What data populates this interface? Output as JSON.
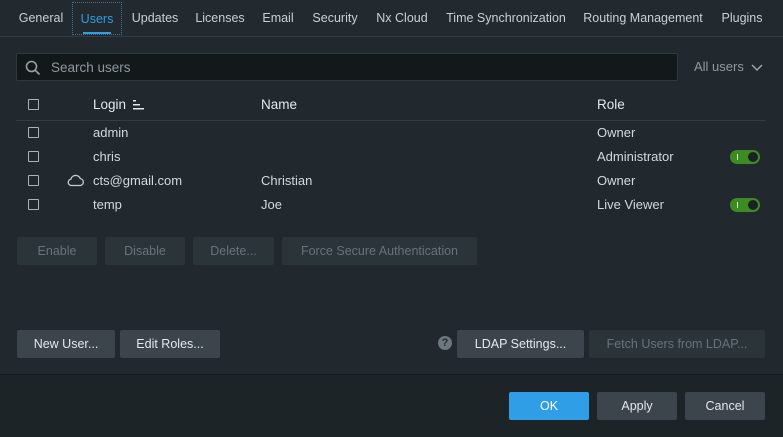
{
  "tabs": [
    {
      "label": "General"
    },
    {
      "label": "Users"
    },
    {
      "label": "Updates"
    },
    {
      "label": "Licenses"
    },
    {
      "label": "Email"
    },
    {
      "label": "Security"
    },
    {
      "label": "Nx Cloud"
    },
    {
      "label": "Time Synchronization"
    },
    {
      "label": "Routing Management"
    },
    {
      "label": "Plugins"
    }
  ],
  "active_tab": "Users",
  "search": {
    "placeholder": "Search users",
    "value": ""
  },
  "filter": {
    "label": "All users"
  },
  "table": {
    "headers": {
      "login": "Login",
      "name": "Name",
      "role": "Role"
    },
    "sort_column": "Login",
    "rows": [
      {
        "login": "admin",
        "name": "",
        "role": "Owner",
        "cloud": false,
        "enabled_toggle": false
      },
      {
        "login": "chris",
        "name": "",
        "role": "Administrator",
        "cloud": false,
        "enabled_toggle": true
      },
      {
        "login": "cts@gmail.com",
        "name": "Christian",
        "role": "Owner",
        "cloud": true,
        "enabled_toggle": false
      },
      {
        "login": "temp",
        "name": "Joe",
        "role": "Live Viewer",
        "cloud": false,
        "enabled_toggle": true
      }
    ]
  },
  "actions": {
    "enable": "Enable",
    "disable": "Disable",
    "delete": "Delete...",
    "force_secure_auth": "Force Secure Authentication"
  },
  "bottom": {
    "new_user": "New User...",
    "edit_roles": "Edit Roles...",
    "help": "?",
    "ldap_settings": "LDAP Settings...",
    "fetch_ldap": "Fetch Users from LDAP..."
  },
  "footer": {
    "ok": "OK",
    "apply": "Apply",
    "cancel": "Cancel"
  },
  "colors": {
    "accent": "#2f9ee6",
    "toggle_on": "#3d8b22",
    "background": "#22292e"
  }
}
